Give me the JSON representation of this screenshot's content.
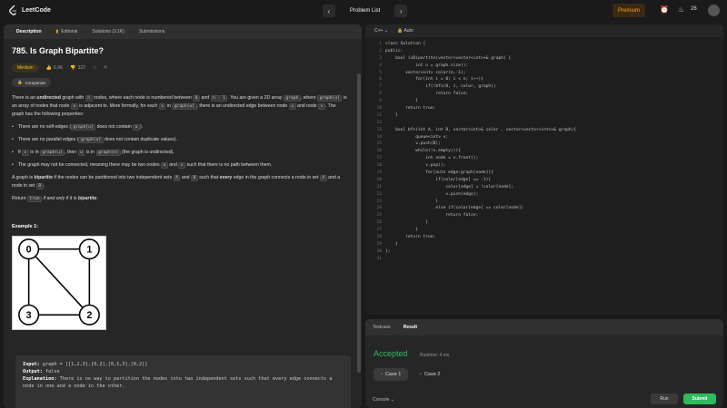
{
  "app": {
    "name": "LeetCode"
  },
  "topbar": {
    "problem_list": "Problem List",
    "premium": "Premium",
    "streak": "26",
    "prev_icon": "chevron-left-icon",
    "next_icon": "chevron-right-icon"
  },
  "left_tabs": [
    {
      "label": "Description"
    },
    {
      "label": "Editorial"
    },
    {
      "label": "Solutions (3.1K)"
    },
    {
      "label": "Submissions"
    }
  ],
  "problem": {
    "title": "785. Is Graph Bipartite?",
    "difficulty": "Medium",
    "likes": "6.6K",
    "dislikes": "322",
    "companies": "Companies",
    "p1_a": "There is an ",
    "p1_b": "undirected",
    "p1_c": " graph with ",
    "p1_code1": "n",
    "p1_d": " nodes, where each node is numbered between ",
    "p1_code2": "0",
    "p1_e": " and ",
    "p1_code3": "n - 1",
    "p1_f": ". You are given a 2D array ",
    "p1_code4": "graph",
    "p1_g": ", where ",
    "p1_code5": "graph[u]",
    "p1_h": " is an array of nodes that node ",
    "p1_code6": "u",
    "p1_i": " is adjacent to. More formally, for each ",
    "p1_code7": "v",
    "p1_j": " in ",
    "p1_code8": "graph[u]",
    "p1_k": ", there is an undirected edge between node ",
    "p1_code9": "u",
    "p1_l": " and node ",
    "p1_code10": "v",
    "p1_m": ". The graph has the following properties:",
    "b1_a": "There are no self-edges (",
    "b1_code": "graph[u]",
    "b1_b": " does not contain ",
    "b1_code2": "u",
    "b1_c": ").",
    "b2_a": "There are no parallel edges (",
    "b2_code": "graph[u]",
    "b2_b": " does not contain duplicate values).",
    "b3_a": "If ",
    "b3_code1": "v",
    "b3_b": " is in ",
    "b3_code2": "graph[u]",
    "b3_c": ", then ",
    "b3_code3": "u",
    "b3_d": " is in ",
    "b3_code4": "graph[v]",
    "b3_e": " (the graph is undirected).",
    "b4_a": "The graph may not be connected, meaning there may be two nodes ",
    "b4_code1": "u",
    "b4_b": " and ",
    "b4_code2": "v",
    "b4_c": " such that there is no path between them.",
    "p2_a": "A graph is ",
    "p2_b": "bipartite",
    "p2_c": " if the nodes can be partitioned into two independent sets ",
    "p2_code1": "A",
    "p2_d": " and ",
    "p2_code2": "B",
    "p2_e": " such that ",
    "p2_f": "every",
    "p2_g": " edge in the graph connects a node in set ",
    "p2_code3": "A",
    "p2_h": " and a node in set ",
    "p2_code4": "B",
    "p2_i": ".",
    "p3_a": "Return ",
    "p3_code": "true",
    "p3_b": " if and only if it is ",
    "p3_c": "bipartite",
    "p3_d": "."
  },
  "example": {
    "title": "Example 1:",
    "nodes": [
      "0",
      "1",
      "2",
      "3"
    ],
    "input_label": "Input:",
    "input_value": " graph = [[1,2,3],[0,2],[0,1,3],[0,2]]",
    "output_label": "Output:",
    "output_value": " false",
    "explanation_label": "Explanation:",
    "explanation_value": " There is no way to partition the nodes into two independent sets such that every edge connects a node in one and a node in the other."
  },
  "editor": {
    "language": "C++",
    "mode": "Auto",
    "code": [
      "class Solution {",
      "public:",
      "    bool isBipartite(vector<vector<int>>& graph) {",
      "            int n = graph.size();",
      "        vector<int> color(n,-1);",
      "            for(int i = 0; i < n; i++){",
      "                if(!bfs(0, i, color, graph))",
      "                    return false;",
      "            }",
      "        return true;",
      "    }",
      "",
      "    bool bfs(int A, int B, vector<int>& color , vector<vector<int>>& graph){",
      "            queue<int> v;",
      "            v.push(B);",
      "            while(!v.empty()){",
      "                int node = v.front();",
      "                v.pop();",
      "                for(auto edge:graph[node]){",
      "                    if(color[edge] == -1){",
      "                        color[edge] = !color[node];",
      "                        v.push(edge);",
      "                    }",
      "                    else if(color[edge] == color[node])",
      "                        return false;",
      "                }",
      "            }",
      "        return true;",
      "    }",
      "};",
      ""
    ]
  },
  "result": {
    "tab_testcase": "Testcase",
    "tab_result": "Result",
    "status": "Accepted",
    "runtime": "Runtime: 4 ms",
    "case1": "Case 1",
    "case2": "Case 2",
    "console": "Console",
    "run": "Run",
    "submit": "Submit"
  },
  "colors": {
    "accent_orange": "#ffa116",
    "accepted_green": "#2cbb5d",
    "medium_yellow": "#ffc01e"
  }
}
